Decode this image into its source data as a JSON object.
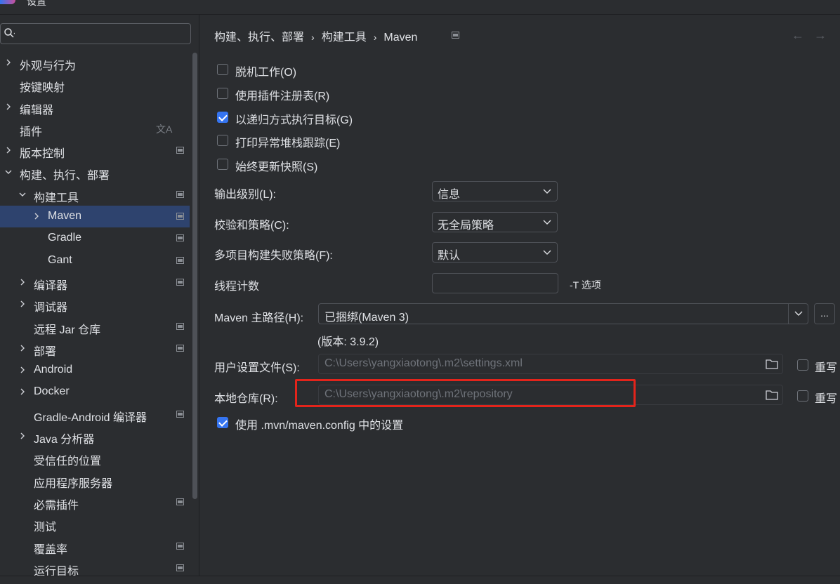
{
  "window": {
    "title": "设置"
  },
  "search": {
    "placeholder": "",
    "value": ""
  },
  "sidebar": {
    "items": [
      {
        "label": "外观与行为",
        "chevron": "right",
        "badge": false
      },
      {
        "label": "按键映射",
        "chevron": "none",
        "badge": false
      },
      {
        "label": "编辑器",
        "chevron": "right",
        "badge": false
      },
      {
        "label": "插件",
        "chevron": "none",
        "badge": false,
        "translate_icon": "文A"
      },
      {
        "label": "版本控制",
        "chevron": "right",
        "badge": true
      },
      {
        "label": "构建、执行、部署",
        "chevron": "down",
        "badge": false
      },
      {
        "label": "构建工具",
        "chevron": "down",
        "badge": true
      },
      {
        "label": "Maven",
        "chevron": "right",
        "badge": true,
        "selected": true
      },
      {
        "label": "Gradle",
        "chevron": "none",
        "badge": true
      },
      {
        "label": "Gant",
        "chevron": "none",
        "badge": true
      },
      {
        "label": "编译器",
        "chevron": "right",
        "badge": true
      },
      {
        "label": "调试器",
        "chevron": "right",
        "badge": false
      },
      {
        "label": "远程 Jar 仓库",
        "chevron": "none",
        "badge": true
      },
      {
        "label": "部署",
        "chevron": "right",
        "badge": true
      },
      {
        "label": "Android",
        "chevron": "right",
        "badge": false
      },
      {
        "label": "Docker",
        "chevron": "right",
        "badge": false
      },
      {
        "label": "Gradle-Android 编译器",
        "chevron": "none",
        "badge": true
      },
      {
        "label": "Java 分析器",
        "chevron": "right",
        "badge": false
      },
      {
        "label": "受信任的位置",
        "chevron": "none",
        "badge": false
      },
      {
        "label": "应用程序服务器",
        "chevron": "none",
        "badge": false
      },
      {
        "label": "必需插件",
        "chevron": "none",
        "badge": true
      },
      {
        "label": "测试",
        "chevron": "none",
        "badge": false
      },
      {
        "label": "覆盖率",
        "chevron": "none",
        "badge": true
      },
      {
        "label": "运行目标",
        "chevron": "none",
        "badge": true
      }
    ]
  },
  "breadcrumb": {
    "items": [
      "构建、执行、部署",
      "构建工具",
      "Maven"
    ],
    "separator": "›"
  },
  "nav": {
    "back": "←",
    "forward": "→"
  },
  "checkboxes": [
    {
      "label": "脱机工作(O)",
      "checked": false
    },
    {
      "label": "使用插件注册表(R)",
      "checked": false
    },
    {
      "label": "以递归方式执行目标(G)",
      "checked": true
    },
    {
      "label": "打印异常堆栈跟踪(E)",
      "checked": false
    },
    {
      "label": "始终更新快照(S)",
      "checked": false
    }
  ],
  "form": {
    "output_level": {
      "label": "输出级别(L):",
      "value": "信息"
    },
    "checksum_policy": {
      "label": "校验和策略(C):",
      "value": "无全局策略"
    },
    "multiproject_fail": {
      "label": "多项目构建失败策略(F):",
      "value": "默认"
    },
    "threads": {
      "label": "线程计数",
      "value": "",
      "hint": "-T 选项"
    },
    "maven_home": {
      "label": "Maven 主路径(H):",
      "value": "已捆绑(Maven 3)",
      "more": "...",
      "version": "(版本: 3.9.2)"
    },
    "user_settings": {
      "label": "用户设置文件(S):",
      "value": "C:\\Users\\yangxiaotong\\.m2\\settings.xml",
      "override": "重写",
      "override_checked": false
    },
    "local_repo": {
      "label": "本地仓库(R):",
      "value": "C:\\Users\\yangxiaotong\\.m2\\repository",
      "override": "重写",
      "override_checked": false
    },
    "use_mvn_config": {
      "label": "使用 .mvn/maven.config 中的设置",
      "checked": true
    }
  },
  "colors": {
    "background": "#2b2d30",
    "selection": "#2e436e",
    "accent": "#3574f0",
    "highlight": "#e3241b"
  }
}
